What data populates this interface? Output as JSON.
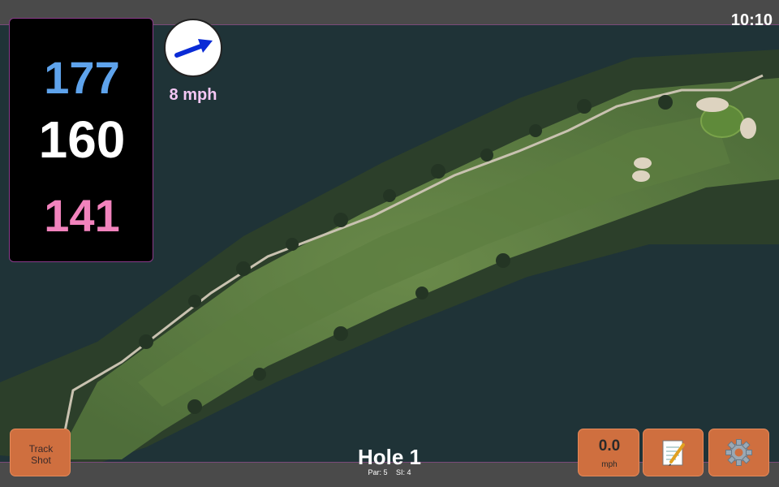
{
  "status": {
    "time": "10:10"
  },
  "distances": {
    "back": "177",
    "middle": "160",
    "front": "141"
  },
  "wind": {
    "speed": "8 mph",
    "direction_icon": "arrow-icon"
  },
  "hole": {
    "title": "Hole 1",
    "par": "Par: 5",
    "si": "SI: 4"
  },
  "buttons": {
    "track_shot": [
      "Track",
      "Shot"
    ],
    "speed_value": "0.0",
    "speed_unit": "mph",
    "notes_icon": "notepad-icon",
    "settings_icon": "gear-icon"
  },
  "colors": {
    "back": "#5ea3ec",
    "middle": "#ffffff",
    "front": "#f283bd",
    "button": "#cf6f3f",
    "wind_text": "#f4c7f4"
  }
}
